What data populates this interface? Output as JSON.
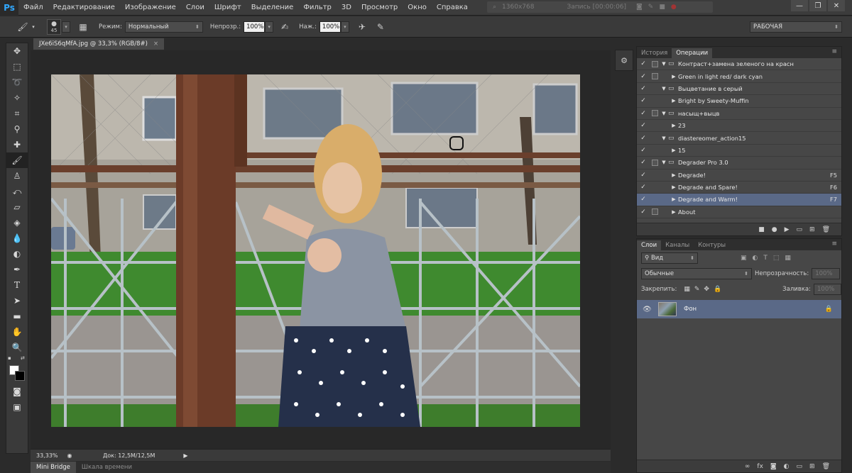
{
  "app": {
    "logo": "Ps"
  },
  "menu": [
    "Файл",
    "Редактирование",
    "Изображение",
    "Слои",
    "Шрифт",
    "Выделение",
    "Фильтр",
    "3D",
    "Просмотр",
    "Окно",
    "Справка"
  ],
  "recording": {
    "resolution": "1360x768",
    "status": "Запись [00:00:06]"
  },
  "window_buttons": [
    "—",
    "❐",
    "✕"
  ],
  "options": {
    "brush_size": "45",
    "mode_label": "Режим:",
    "mode_value": "Нормальный",
    "opacity_label": "Непрозр.:",
    "opacity_value": "100%",
    "pressure_label": "Наж.:",
    "pressure_value": "100%",
    "workspace": "РАБОЧАЯ"
  },
  "document": {
    "tab_title": "JXe6iS6qMfA.jpg @ 33,3% (RGB/8#)",
    "zoom": "33,33%",
    "doc_size": "Док: 12,5M/12,5M"
  },
  "bottom_tabs": [
    "Mini Bridge",
    "Шкала времени"
  ],
  "actions_panel": {
    "tabs": [
      "История",
      "Операции"
    ],
    "items": [
      {
        "name": "Контраст+замена зеленого на красн",
        "level": 0,
        "folder": true,
        "expanded": true,
        "dialog": true
      },
      {
        "name": "Green in light red/ dark cyan",
        "level": 1,
        "folder": false,
        "expanded": false,
        "dialog": true
      },
      {
        "name": "Выцветание в серый",
        "level": 0,
        "folder": true,
        "expanded": true,
        "dialog": false
      },
      {
        "name": "Bright by Sweety-Muffin",
        "level": 1,
        "folder": false,
        "expanded": false,
        "dialog": false
      },
      {
        "name": "насыщ+выцв",
        "level": 0,
        "folder": true,
        "expanded": true,
        "dialog": true
      },
      {
        "name": "23",
        "level": 1,
        "folder": false,
        "expanded": false,
        "dialog": false
      },
      {
        "name": "diastereomer_action15",
        "level": 0,
        "folder": true,
        "expanded": true,
        "dialog": false
      },
      {
        "name": "15",
        "level": 1,
        "folder": false,
        "expanded": false,
        "dialog": false
      },
      {
        "name": "Degrader Pro 3.0",
        "level": 0,
        "folder": true,
        "expanded": true,
        "dialog": true
      },
      {
        "name": "Degrade!",
        "level": 1,
        "folder": false,
        "expanded": false,
        "dialog": false,
        "key": "F5"
      },
      {
        "name": "Degrade and Spare!",
        "level": 1,
        "folder": false,
        "expanded": false,
        "dialog": false,
        "key": "F6"
      },
      {
        "name": "Degrade and Warm!",
        "level": 1,
        "folder": false,
        "expanded": false,
        "dialog": false,
        "key": "F7",
        "selected": true
      },
      {
        "name": "About",
        "level": 1,
        "folder": false,
        "expanded": false,
        "dialog": true
      }
    ]
  },
  "layers_panel": {
    "tabs": [
      "Слои",
      "Каналы",
      "Контуры"
    ],
    "filter": "Вид",
    "blend": "Обычные",
    "opacity_label": "Непрозрачность:",
    "opacity_value": "100%",
    "lock_label": "Закрепить:",
    "fill_label": "Заливка:",
    "fill_value": "100%",
    "layers": [
      {
        "name": "Фон",
        "locked": true,
        "visible": true
      }
    ]
  },
  "colors": {
    "selection": "#5a6987",
    "panel": "#474747",
    "accent": "#31a8ff"
  }
}
